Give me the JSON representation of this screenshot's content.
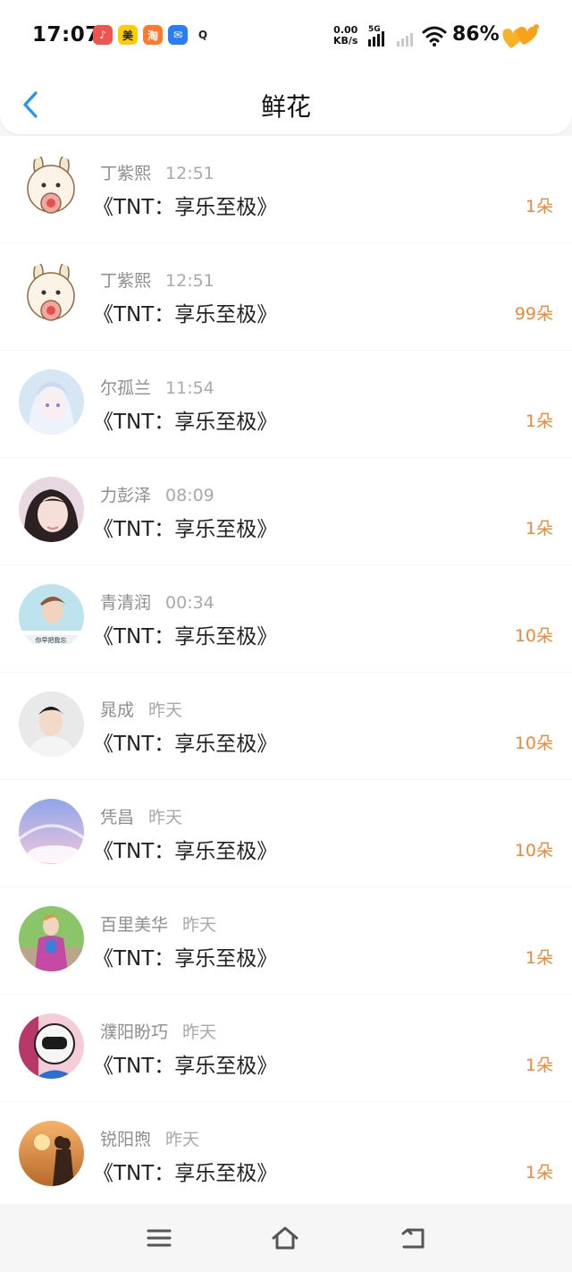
{
  "status_bar": {
    "time": "17:07",
    "net_speed_value": "0.00",
    "net_speed_unit": "KB/s",
    "network_type": "5G",
    "battery": "86%",
    "app_icons": [
      {
        "icon": "douyin-icon",
        "color": "#f0544e",
        "glyph": "♪"
      },
      {
        "icon": "meituan-icon",
        "color": "#ffcc00",
        "glyph": "美"
      },
      {
        "icon": "taobao-icon",
        "color": "#ff7a2b",
        "glyph": "淘"
      },
      {
        "icon": "mail-icon",
        "color": "#2b7cf7",
        "glyph": "✉"
      },
      {
        "icon": "qq-icon",
        "color": "#222222",
        "glyph": "Q"
      }
    ]
  },
  "header": {
    "title": "鲜花"
  },
  "colors": {
    "accent": "#2196f3",
    "count": "#ee8a37"
  },
  "items": [
    {
      "name": "丁紫熙",
      "time": "12:51",
      "gift": "《TNT：享乐至极》",
      "count": "1朵",
      "avatar": "cartoon"
    },
    {
      "name": "丁紫熙",
      "time": "12:51",
      "gift": "《TNT：享乐至极》",
      "count": "99朵",
      "avatar": "cartoon"
    },
    {
      "name": "尔孤兰",
      "time": "11:54",
      "gift": "《TNT：享乐至极》",
      "count": "1朵",
      "avatar": "anime"
    },
    {
      "name": "力彭泽",
      "time": "08:09",
      "gift": "《TNT：享乐至极》",
      "count": "1朵",
      "avatar": "girl"
    },
    {
      "name": "青清润",
      "time": "00:34",
      "gift": "《TNT：享乐至极》",
      "count": "10朵",
      "avatar": "boy"
    },
    {
      "name": "晁成",
      "time": "昨天",
      "gift": "《TNT：享乐至极》",
      "count": "10朵",
      "avatar": "portrait"
    },
    {
      "name": "凭昌",
      "time": "昨天",
      "gift": "《TNT：享乐至极》",
      "count": "10朵",
      "avatar": "sky"
    },
    {
      "name": "百里美华",
      "time": "昨天",
      "gift": "《TNT：享乐至极》",
      "count": "1朵",
      "avatar": "street"
    },
    {
      "name": "濮阳盼巧",
      "time": "昨天",
      "gift": "《TNT：享乐至极》",
      "count": "1朵",
      "avatar": "helmet"
    },
    {
      "name": "锐阳煦",
      "time": "昨天",
      "gift": "《TNT：享乐至极》",
      "count": "1朵",
      "avatar": "sunset"
    }
  ],
  "bottom_nav": [
    {
      "icon": "menu-icon"
    },
    {
      "icon": "home-icon"
    },
    {
      "icon": "back-nav-icon"
    }
  ]
}
